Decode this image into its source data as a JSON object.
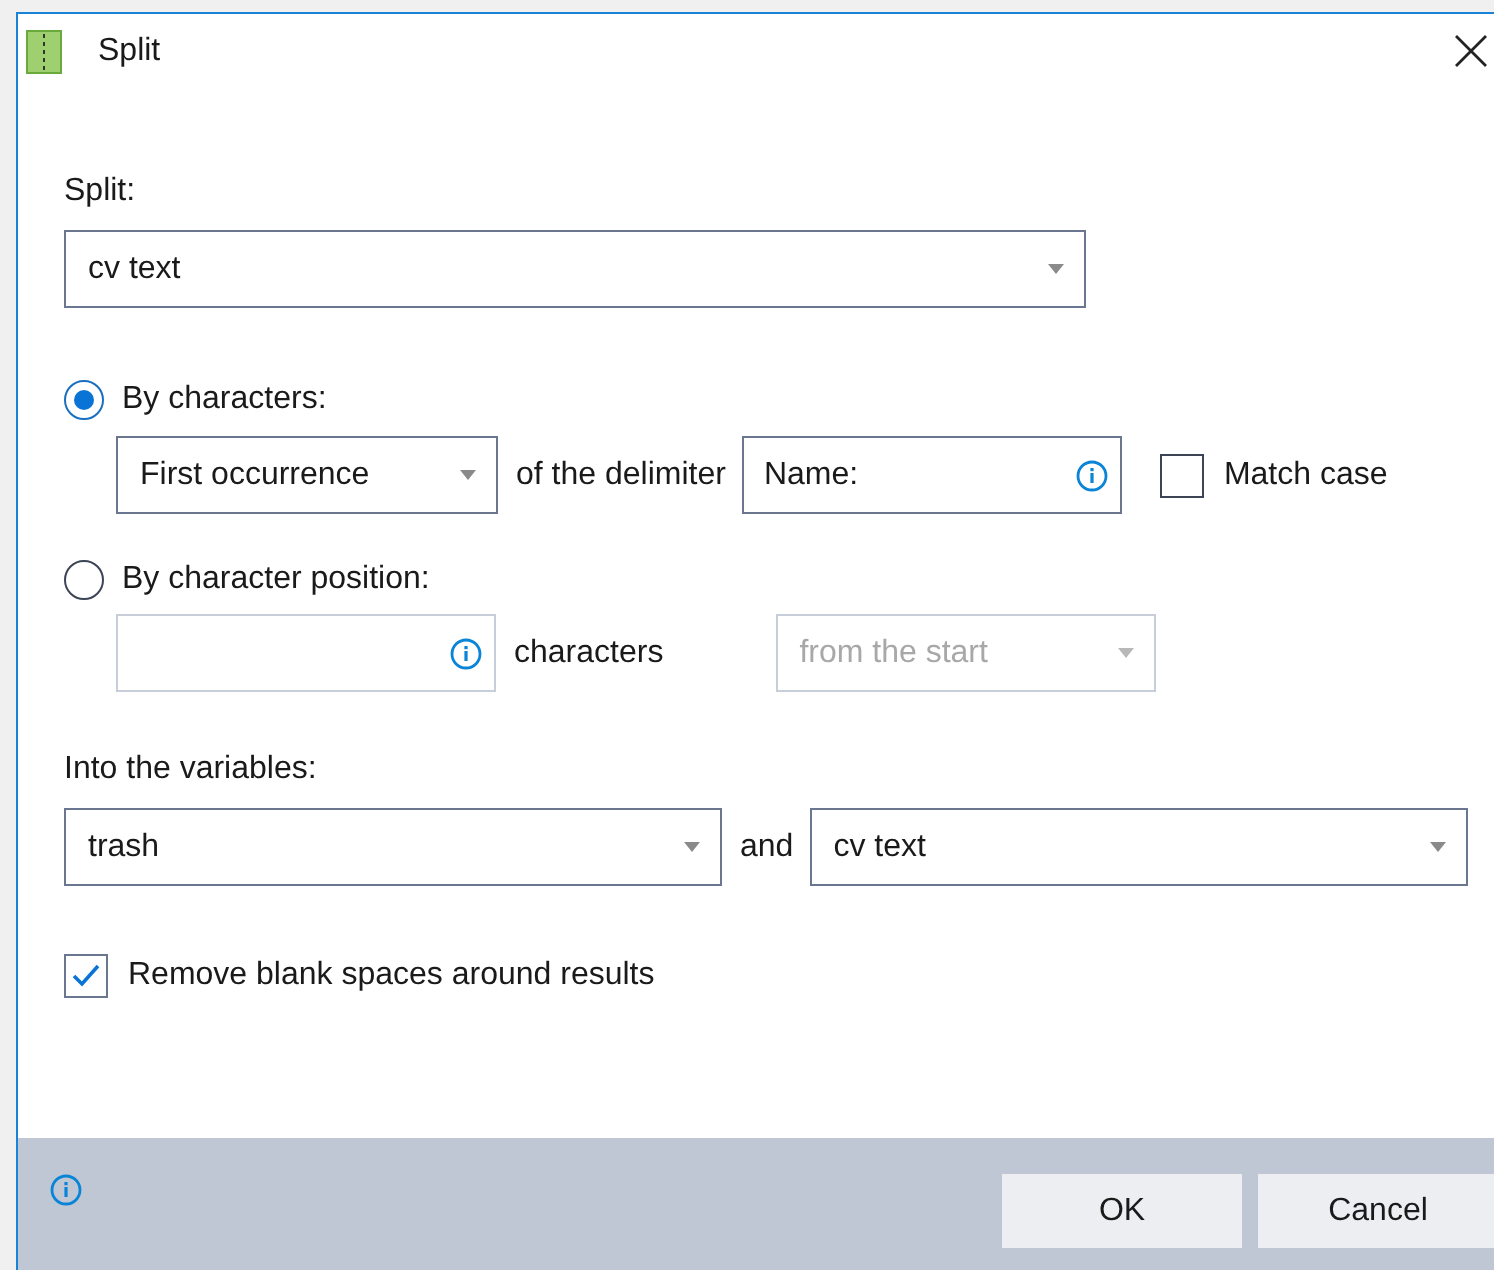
{
  "window": {
    "title": "Split"
  },
  "split": {
    "label": "Split:",
    "value": "cv text"
  },
  "modes": [
    {
      "label": "By characters:",
      "selected": true
    },
    {
      "label": "By character position:",
      "selected": false
    }
  ],
  "by_characters": {
    "occurrence": "First occurrence",
    "connector": "of the delimiter",
    "delimiter": "Name:",
    "match_case": {
      "label": "Match case",
      "checked": false
    }
  },
  "by_position": {
    "disabled": true,
    "unit": "characters",
    "direction": "from the start"
  },
  "variables": {
    "label": "Into the variables:",
    "first": "trash",
    "connector": "and",
    "second": "cv text"
  },
  "trim": {
    "label": "Remove blank spaces around results",
    "checked": true
  },
  "buttons": [
    {
      "label": "OK"
    },
    {
      "label": "Cancel"
    }
  ]
}
